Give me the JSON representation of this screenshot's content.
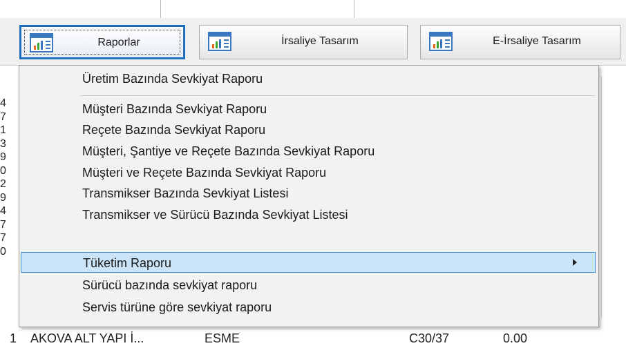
{
  "toolbar": {
    "buttons": [
      {
        "label": "Raporlar",
        "icon": "report-chart-icon"
      },
      {
        "label": "İrsaliye Tasarım",
        "icon": "report-chart-icon"
      },
      {
        "label": "E-İrsaliye Tasarım",
        "icon": "report-chart-icon"
      }
    ]
  },
  "menu": {
    "items": [
      {
        "label": "Üretim Bazında Sevkiyat Raporu"
      },
      {
        "label": "Müşteri Bazında Sevkiyat Raporu"
      },
      {
        "label": "Reçete Bazında Sevkiyat Raporu"
      },
      {
        "label": "Müşteri, Şantiye ve Reçete Bazında Sevkiyat Raporu"
      },
      {
        "label": "Müşteri ve Reçete Bazında Sevkiyat Raporu"
      },
      {
        "label": "Transmikser Bazında Sevkiyat Listesi"
      },
      {
        "label": "Transmikser ve Sürücü Bazında Sevkiyat Listesi"
      },
      {
        "label": "Tüketim Raporu",
        "highlighted": true,
        "submenu": true
      },
      {
        "label": "Sürücü bazında sevkiyat raporu"
      },
      {
        "label": "Servis türüne göre sevkiyat raporu"
      }
    ]
  },
  "grid": {
    "left_digits": [
      "4",
      "7",
      "1",
      "3",
      "9",
      "0",
      "2",
      "9",
      "4",
      "7",
      "7",
      "0"
    ],
    "bottom_row": {
      "col1": "1",
      "col2": "AKOVA ALT YAPI İ...",
      "col3": "ESME",
      "col4": "C30/37",
      "col5": "0.00"
    }
  },
  "colors": {
    "highlight_bg": "#cce4f7",
    "highlight_border": "#3f8fd6",
    "active_button_border": "#1d6fc4"
  }
}
